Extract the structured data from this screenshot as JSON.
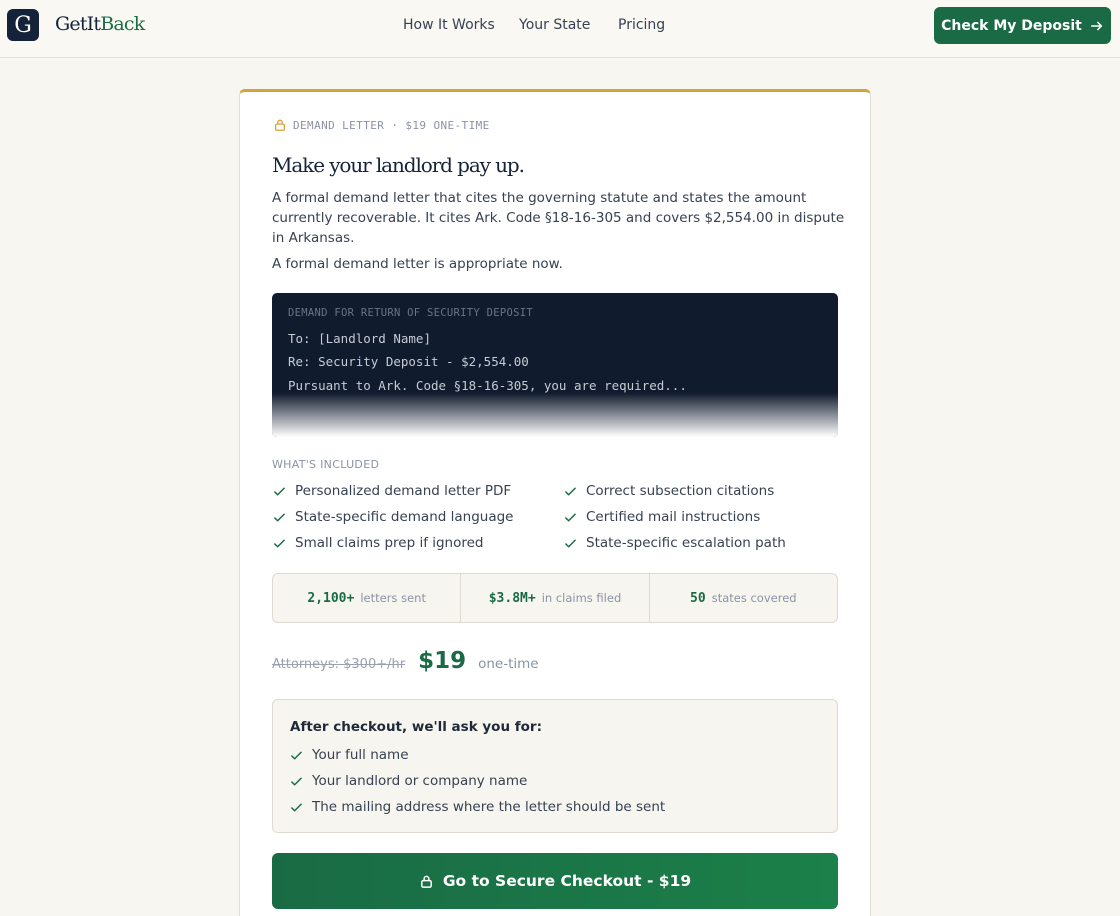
{
  "header": {
    "logo_letter": "G",
    "logo_text_main": "GetIt",
    "logo_text_accent": "Back",
    "nav": [
      "How It Works",
      "Your State",
      "Pricing"
    ],
    "cta_label": "Check My Deposit"
  },
  "card": {
    "eyebrow": "DEMAND LETTER · $19 ONE-TIME",
    "title": "Make your landlord pay up.",
    "description": "A formal demand letter that cites the governing statute and states the amount currently recoverable. It cites Ark. Code §18-16-305 and covers $2,554.00 in dispute in Arkansas.",
    "description2": "A formal demand letter is appropriate now.",
    "preview": {
      "heading": "DEMAND FOR RETURN OF SECURITY DEPOSIT",
      "line1": "To: [Landlord Name]",
      "line2": "Re: Security Deposit - $2,554.00",
      "line3": "Pursuant to Ark. Code §18-16-305, you are required..."
    },
    "included_label": "WHAT'S INCLUDED",
    "features_left": [
      "Personalized demand letter PDF",
      "State-specific demand language",
      "Small claims prep if ignored"
    ],
    "features_right": [
      "Correct subsection citations",
      "Certified mail instructions",
      "State-specific escalation path"
    ],
    "stats": [
      {
        "num": "2,100+",
        "label": "letters sent"
      },
      {
        "num": "$3.8M+",
        "label": "in claims filed"
      },
      {
        "num": "50",
        "label": "states covered"
      }
    ],
    "price": {
      "old": "Attorneys: $300+/hr",
      "new": "$19",
      "note": "one-time"
    },
    "after_checkout": {
      "title": "After checkout, we'll ask you for:",
      "items": [
        "Your full name",
        "Your landlord or company name",
        "The mailing address where the letter should be sent"
      ]
    },
    "checkout_label": "Go to Secure Checkout - $19"
  },
  "colors": {
    "brand_green": "#1a6b45",
    "accent_gold": "#d4a43b",
    "navy": "#14223a"
  },
  "icons": [
    "lock-icon",
    "check-icon",
    "arrow-right-icon"
  ]
}
